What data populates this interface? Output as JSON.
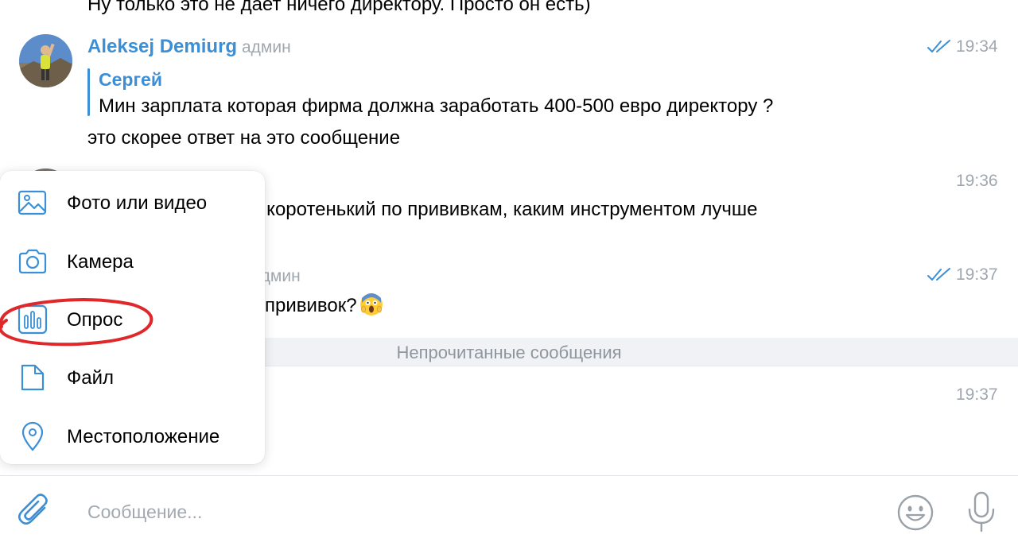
{
  "messages": {
    "top_partial": "Ну только это не дает ничего директору. Просто он есть)",
    "m1": {
      "sender": "Aleksej Demiurg",
      "role": "админ",
      "time": "19:34",
      "reply_name": "Сергей",
      "reply_text": "Мин зарплата которая фирма должна заработать 400-500 евро директору ?",
      "text": "это скорее ответ на это сообщение"
    },
    "m2": {
      "time": "19:36",
      "text": "ь коротенький по прививкам, каким инструментом лучше"
    },
    "m3": {
      "role": "админ",
      "time": "19:37",
      "text": "прививок?"
    },
    "m4": {
      "time": "19:37"
    }
  },
  "unread_label": "Непрочитанные сообщения",
  "attach_menu": {
    "items": [
      {
        "label": "Фото или видео",
        "icon": "photo-icon"
      },
      {
        "label": "Камера",
        "icon": "camera-icon"
      },
      {
        "label": "Опрос",
        "icon": "poll-icon"
      },
      {
        "label": "Файл",
        "icon": "file-icon"
      },
      {
        "label": "Местоположение",
        "icon": "location-icon"
      }
    ]
  },
  "input": {
    "placeholder": "Сообщение...",
    "value": ""
  },
  "colors": {
    "accent": "#3a8fd6",
    "time": "#a0a7af",
    "highlight": "#e0282a"
  }
}
